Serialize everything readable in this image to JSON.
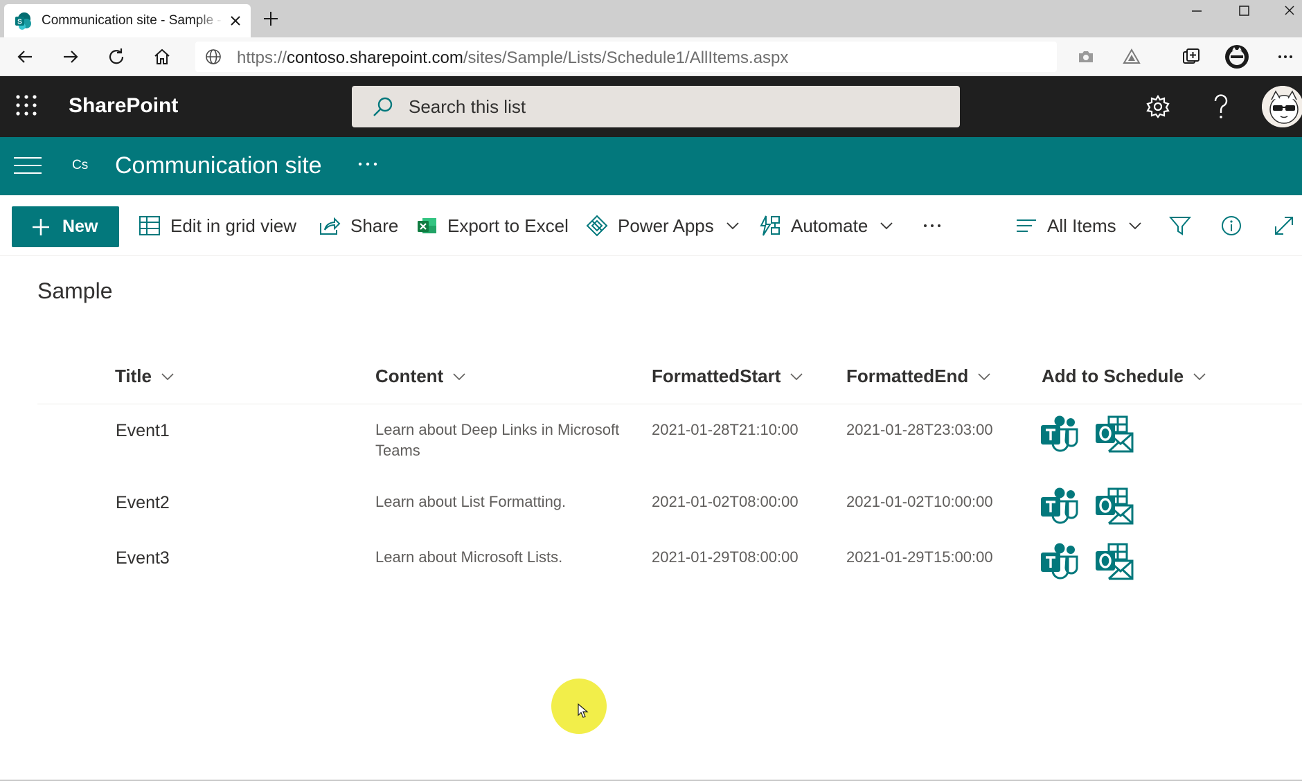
{
  "browser": {
    "tab_title": "Communication site - Sample - All Items",
    "url_prefix": "https://",
    "url_domain": "contoso.sharepoint.com",
    "url_path": "/sites/Sample/Lists/Schedule1/AllItems.aspx",
    "icons": [
      "back-icon",
      "forward-icon",
      "refresh-icon",
      "home-icon",
      "globe-icon",
      "camera-icon",
      "warning-icon",
      "collections-icon",
      "profile-icon",
      "more-icon"
    ]
  },
  "suite_bar": {
    "brand": "SharePoint",
    "search_placeholder": "Search this list",
    "icons": [
      "app-launcher-icon",
      "search-icon",
      "settings-icon",
      "help-icon",
      "avatar"
    ]
  },
  "site": {
    "logo_text": "Cs",
    "title": "Communication site",
    "color": "#03787c"
  },
  "commands": {
    "new": "New",
    "edit_grid": "Edit in grid view",
    "share": "Share",
    "export_excel": "Export to Excel",
    "power_apps": "Power Apps",
    "automate": "Automate",
    "view": "All Items"
  },
  "list": {
    "title": "Sample",
    "columns": [
      "Title",
      "Content",
      "FormattedStart",
      "FormattedEnd",
      "Add to Schedule"
    ],
    "rows": [
      {
        "title": "Event1",
        "content": "Learn about Deep Links in Microsoft Teams",
        "start": "2021-01-28T21:10:00",
        "end": "2021-01-28T23:03:00"
      },
      {
        "title": "Event2",
        "content": "Learn about List Formatting.",
        "start": "2021-01-02T08:00:00",
        "end": "2021-01-02T10:00:00"
      },
      {
        "title": "Event3",
        "content": "Learn about Microsoft Lists.",
        "start": "2021-01-29T08:00:00",
        "end": "2021-01-29T15:00:00"
      }
    ],
    "action_icons": [
      "teams-icon",
      "outlook-icon"
    ]
  }
}
